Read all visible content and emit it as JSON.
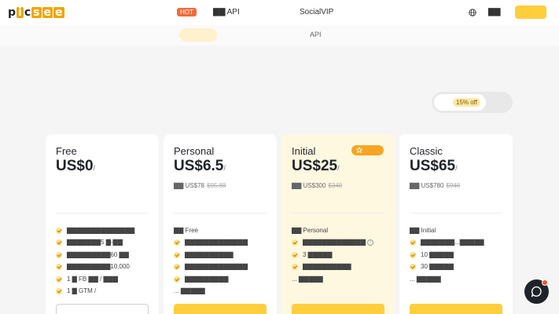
{
  "header": {
    "logo_letters": [
      "p",
      "i",
      "c",
      "s",
      "e",
      "e"
    ],
    "hot_badge": "HOT",
    "nav_api": "▇▇ API",
    "nav_social": "SocialVIP",
    "globe_icon": "globe-icon",
    "lang_label": "▇▇"
  },
  "subnav": {
    "api_label": "API"
  },
  "billing_toggle": {
    "discount": "15% off"
  },
  "plans": [
    {
      "name": "Free",
      "price": "US$0",
      "per": "/",
      "yearly": "",
      "yearly_strike": "",
      "prefix": "",
      "features": [
        "▇▇▇▇▇▇▇▇▇▇▇▇▇▇",
        "▇▇▇▇▇▇▇5 ▇-▇▇",
        "▇▇▇▇▇▇▇▇▇60 ▇▇",
        "▇▇▇▇▇▇▇▇▇10,000",
        "1 ▇ FB ▇▇ / ▇▇▇",
        "1 ▇ GTM /"
      ],
      "more": ""
    },
    {
      "name": "Personal",
      "price": "US$6.5",
      "per": "/",
      "yearly": "▇▇ US$78",
      "yearly_strike": "$95.88",
      "prefix": "▇▇ Free",
      "features": [
        "▇▇▇▇▇▇▇▇▇▇▇▇▇",
        "▇▇▇▇▇▇▇▇▇▇",
        "▇▇▇▇▇▇▇▇▇▇▇▇▇",
        "▇▇▇▇▇▇▇▇▇"
      ],
      "more": "... ▇▇▇▇▇"
    },
    {
      "name": "Initial",
      "price": "US$25",
      "per": "/",
      "yearly": "▇▇ US$300",
      "yearly_strike": "$348",
      "prefix": "▇▇ Personal",
      "features": [
        "▇▇▇▇▇▇▇▇▇▇▇▇▇",
        "3 ▇▇▇▇▇",
        "▇▇▇▇▇▇▇▇▇▇"
      ],
      "more": "... ▇▇▇▇▇",
      "badge_icon": "star-icon"
    },
    {
      "name": "Classic",
      "price": "US$65",
      "per": "/",
      "yearly": "▇▇ US$780",
      "yearly_strike": "$948",
      "prefix": "▇▇ Initial",
      "features": [
        "▇▇▇▇▇▇▇...▇▇▇▇▇",
        "10 ▇▇▇▇▇",
        "30 ▇▇▇▇▇"
      ],
      "more": "... ▇▇▇▇▇"
    }
  ],
  "colors": {
    "accent": "#ffce3d",
    "hot": "#f26b3a",
    "featured_bg": "#fff8e1",
    "chat": "#1f2329"
  },
  "chat_widget": {
    "icon": "chat-bubble-icon"
  }
}
